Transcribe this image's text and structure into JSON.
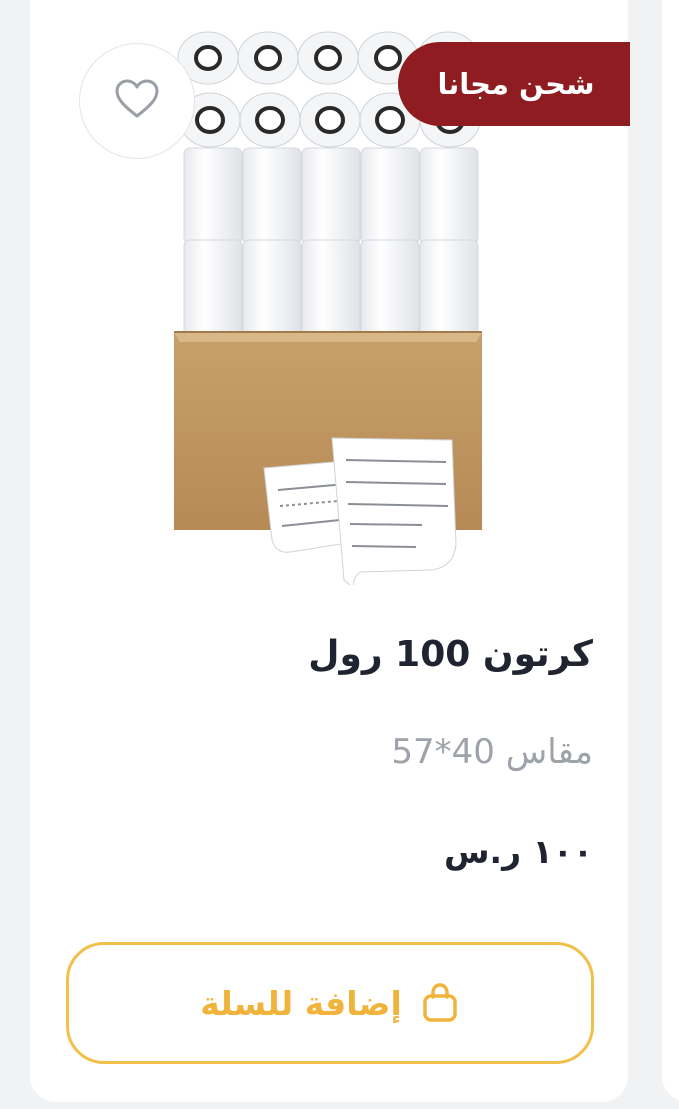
{
  "product": {
    "badge": "شحن مجانا",
    "title": "كرتون 100 رول",
    "subtitle": "مقاس 40*57",
    "price": "١٠٠ ر.س",
    "add_to_cart_label": "إضافة للسلة"
  },
  "colors": {
    "badge_bg": "#8e1c20",
    "accent": "#f2c04a",
    "title": "#1f2430",
    "subtitle": "#9ea3aa"
  },
  "icons": {
    "favorite": "heart-icon",
    "cart": "shopping-bag-icon"
  }
}
